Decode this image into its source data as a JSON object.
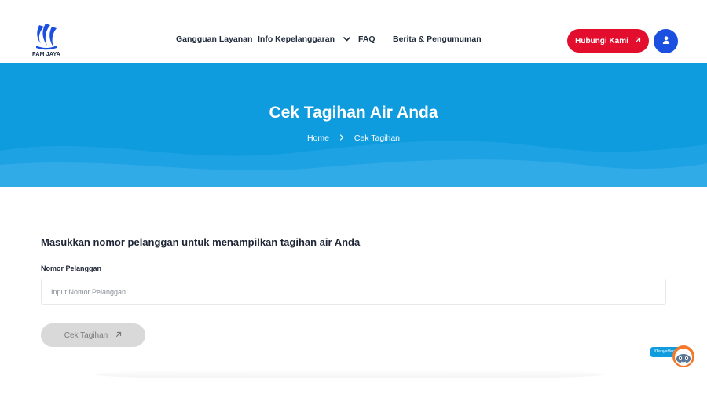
{
  "brand": {
    "logo_text": "PAM JAYA",
    "primary_color": "#0e9cdf",
    "accent_red": "#e30d2d",
    "accent_blue": "#1a4fe0"
  },
  "nav": {
    "items": [
      {
        "label": "Gangguan Layanan"
      },
      {
        "label": "Info Kepelanggaran",
        "has_dropdown": true,
        "icon": "chevron-down-icon"
      },
      {
        "label": "FAQ"
      },
      {
        "label": "Berita & Pengumuman"
      }
    ],
    "contact_button": {
      "label": "Hubungi Kami",
      "icon": "arrow-up-right-icon"
    },
    "user_button": {
      "icon": "user-icon"
    }
  },
  "hero": {
    "title": "Cek Tagihan Air Anda",
    "breadcrumb": [
      {
        "label": "Home"
      },
      {
        "label": "Cek Tagihan"
      }
    ],
    "separator_icon": "chevron-right-icon"
  },
  "form": {
    "heading": "Masukkan nomor pelanggan untuk menampilkan tagihan air Anda",
    "field_label": "Nomor Pelanggan",
    "input_value": "",
    "input_placeholder": "Input Nomor Pelanggan",
    "submit_label": "Cek Tagihan",
    "submit_icon": "arrow-up-right-icon",
    "submit_disabled": true
  },
  "chat": {
    "tag": "#TanyaVeryo",
    "icon": "chat-mascot-icon"
  }
}
